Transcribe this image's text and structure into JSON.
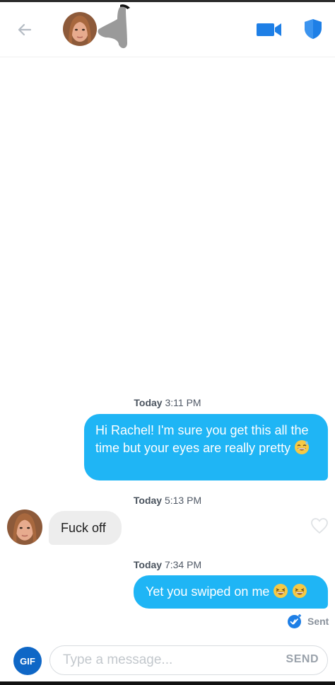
{
  "header": {
    "back_icon": "arrow-left-icon",
    "video_icon": "video-camera-icon",
    "safety_icon": "shield-icon"
  },
  "messages": [
    {
      "timestamp": {
        "day": "Today",
        "time": "3:11 PM"
      },
      "direction": "outgoing",
      "text": "Hi Rachel! I'm sure you get this all the time but your eyes are really pretty"
    },
    {
      "timestamp": {
        "day": "Today",
        "time": "5:13 PM"
      },
      "direction": "incoming",
      "text": "Fuck off"
    },
    {
      "timestamp": {
        "day": "Today",
        "time": "7:34 PM"
      },
      "direction": "outgoing",
      "text": "Yet you swiped on me"
    }
  ],
  "status": {
    "sent_label": "Sent"
  },
  "composer": {
    "gif_label": "GIF",
    "placeholder": "Type a message...",
    "send_label": "SEND"
  },
  "colors": {
    "accent": "#1fb5f5",
    "icon_blue": "#1e7fe6",
    "gif_blue": "#0f67c6",
    "incoming_bubble": "#ededed"
  }
}
